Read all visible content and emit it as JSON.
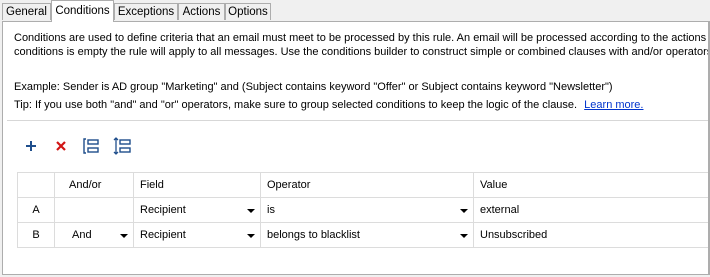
{
  "tabs": [
    "General",
    "Conditions",
    "Exceptions",
    "Actions",
    "Options"
  ],
  "description": {
    "line1": "Conditions are used to define criteria that an email must meet to be processed by this rule. An email will be processed according to the actions define",
    "line2": "conditions is empty the rule will apply to all messages. Use the conditions builder to construct simple or combined clauses with and/or operators and g"
  },
  "example": "Example: Sender is AD group \"Marketing\" and (Subject contains keyword \"Offer\" or Subject contains keyword \"Newsletter\")",
  "tip": {
    "text": "Tip: If you use both \"and\" and \"or\" operators, make sure to group selected conditions to keep the logic of the clause.",
    "link": "Learn more."
  },
  "toolbar": {
    "add_icon": "plus-icon",
    "delete_icon": "delete-x-icon",
    "group_icon": "group-conditions-icon",
    "ungroup_icon": "ungroup-conditions-icon",
    "add_color": "#1f4e8c",
    "delete_color": "#d11414"
  },
  "grid": {
    "headers": [
      "",
      "And/or",
      "Field",
      "Operator",
      "Value"
    ],
    "rows": [
      {
        "id": "A",
        "andor": "",
        "field": "Recipient",
        "operator": "is",
        "value": "external"
      },
      {
        "id": "B",
        "andor": "And",
        "field": "Recipient",
        "operator": "belongs to blacklist",
        "value": "Unsubscribed"
      }
    ]
  }
}
